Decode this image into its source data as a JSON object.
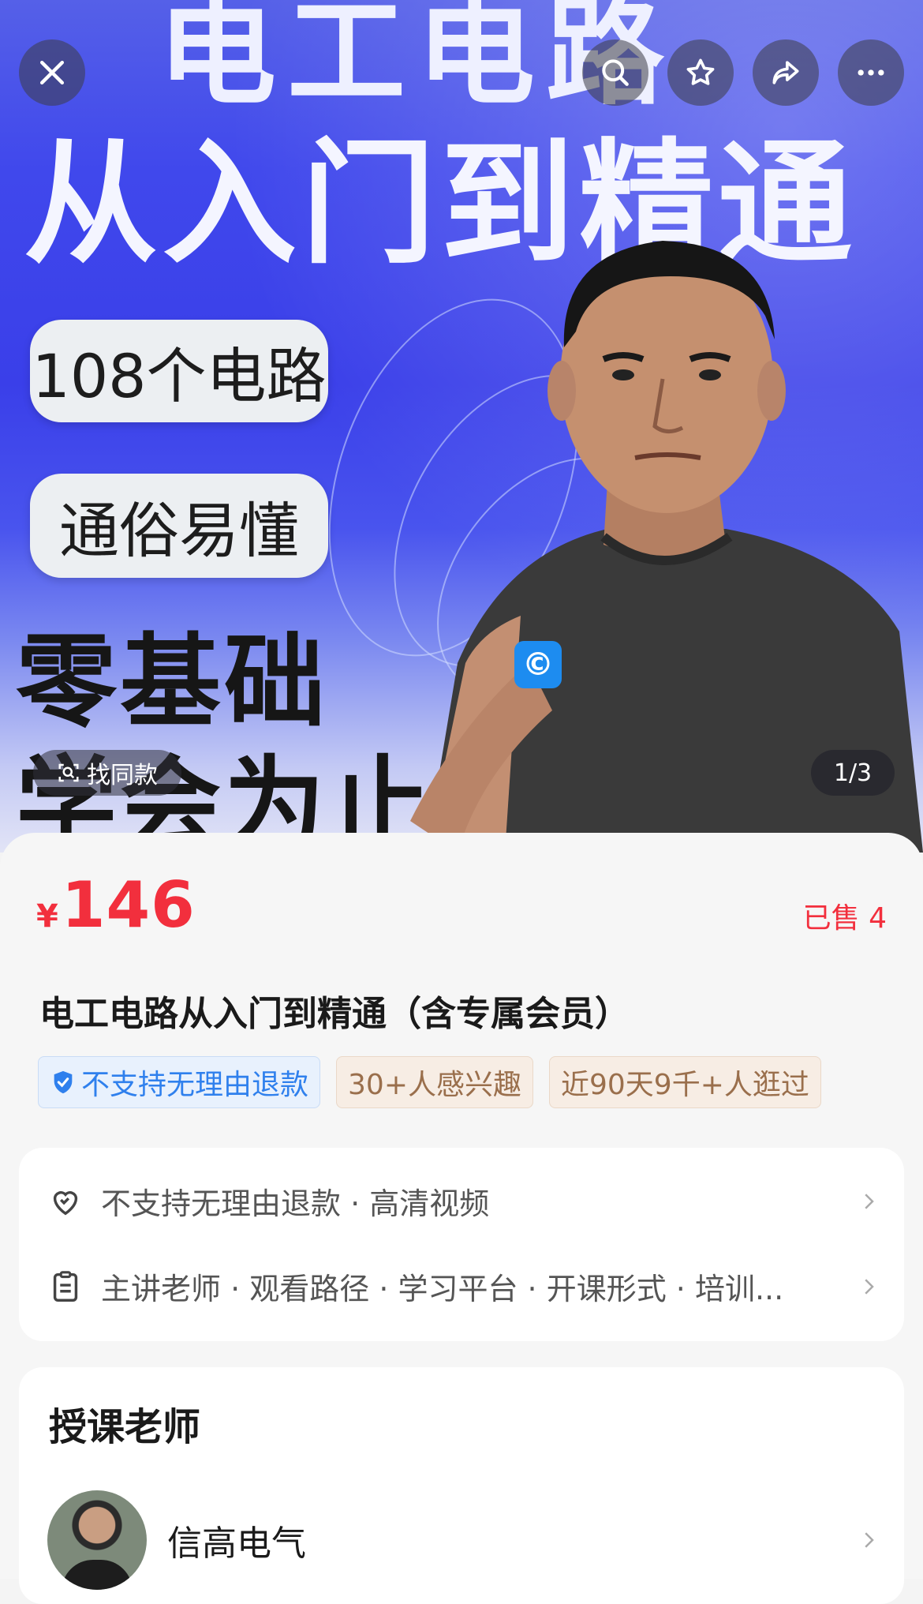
{
  "hero": {
    "title_top": "电工电路",
    "title_main": "从入门到精通",
    "pill1": "108个电路",
    "pill2": "通俗易懂",
    "big1": "零基础",
    "big2": "学会为止",
    "find_same": "找同款",
    "page_indicator": "1/3"
  },
  "top_buttons": {
    "close": "close-icon",
    "search": "search-icon",
    "favorite": "star-icon",
    "share": "share-icon",
    "more": "more-icon"
  },
  "product": {
    "price_symbol": "¥",
    "price": "146",
    "sold": "已售 4",
    "title": "电工电路从入门到精通（含专属会员）",
    "tags": [
      "不支持无理由退款",
      "30+人感兴趣",
      "近90天9千+人逛过"
    ]
  },
  "info": {
    "row1": "不支持无理由退款 · 高清视频",
    "row2": "主讲老师 · 观看路径 · 学习平台 · 开课形式 · 培训..."
  },
  "teacher": {
    "heading": "授课老师",
    "name": "信高电气"
  },
  "colors": {
    "price_red": "#f22f3d",
    "tag_blue": "#2f80ed",
    "tag_brown": "#9a6f4c",
    "hero_blue": "#3a3fe9"
  }
}
